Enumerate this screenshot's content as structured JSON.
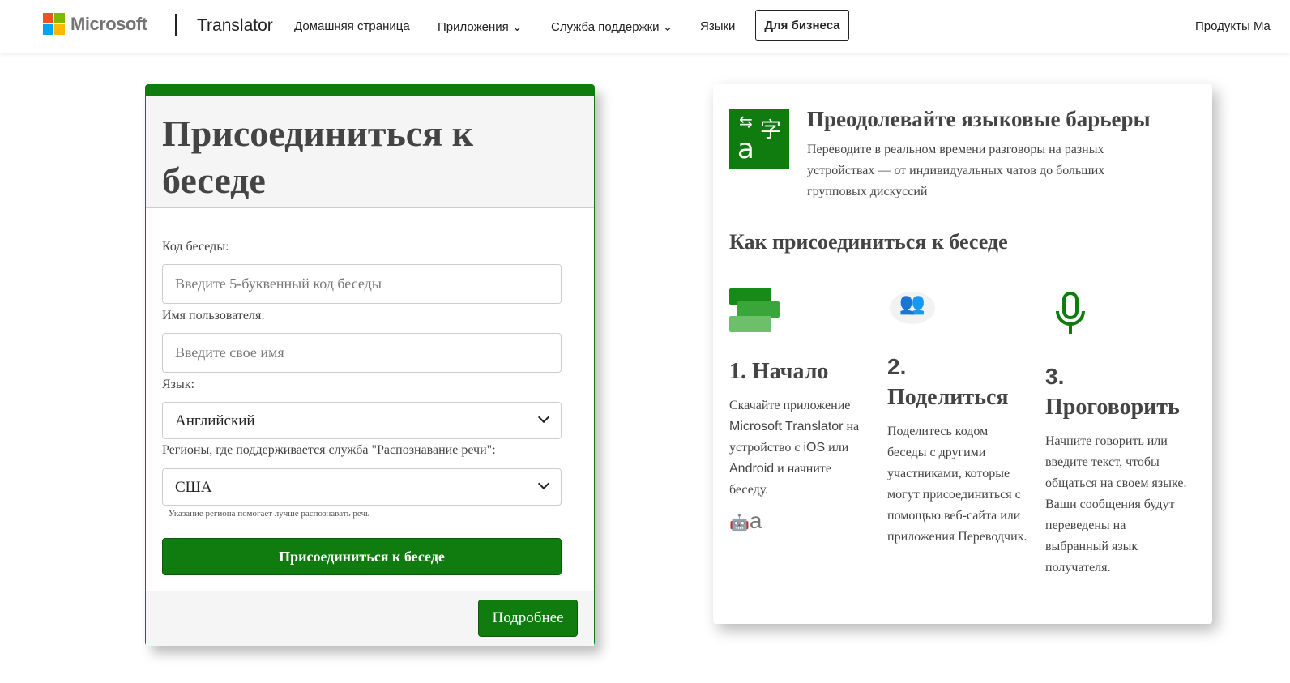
{
  "header": {
    "logo_text": "Microsoft",
    "brand": "Translator",
    "nav": [
      {
        "label": "Домашняя страница"
      },
      {
        "label": "Приложения"
      },
      {
        "label": "Служба поддержки"
      },
      {
        "label": "Языки"
      }
    ],
    "business_button": "Для бизнеса",
    "right_link": "Продукты Ma"
  },
  "join_form": {
    "title": "Присоединиться к беседе",
    "code_label": "Код беседы:",
    "code_placeholder": "Введите 5-буквенный код беседы",
    "name_label": "Имя пользователя:",
    "name_placeholder": "Введите свое имя",
    "language_label": "Язык:",
    "language_value": "Английский",
    "region_label": "Регионы, где поддерживается служба \"Распознавание речи\":",
    "region_value": "США",
    "region_hint": "Указание региона помогает лучше распознавать речь",
    "join_button": "Присоединиться к беседе",
    "more_button": "Подробнее"
  },
  "info": {
    "title": "Преодолевайте языковые барьеры",
    "subtitle": "Переводите в реальном времени разговоры на разных устройствах — от индивидуальных чатов до больших групповых дискуссий",
    "how_title": "Как присоединиться к беседе",
    "steps": [
      {
        "icon": "chat-devices-icon",
        "title": "1. Начало",
        "text_a": "Скачайте приложение ",
        "text_b": "Microsoft Translator",
        "text_c": " на устройство с ",
        "text_d": "iOS",
        "text_e": " или ",
        "text_f": "Android",
        "text_g": " и начните беседу."
      },
      {
        "icon": "group-add-icon",
        "num": "2.",
        "title": "Поделиться",
        "text": "Поделитесь кодом беседы с другими участниками, которые могут присоединиться с помощью веб-сайта или приложения Переводчик."
      },
      {
        "icon": "microphone-icon",
        "num": "3.",
        "title": "Проговорить",
        "text": "Начните говорить или введите текст, чтобы общаться на своем языке. Ваши сообщения будут переведены на выбранный язык получателя."
      }
    ]
  },
  "colors": {
    "accent": "#107c10"
  }
}
